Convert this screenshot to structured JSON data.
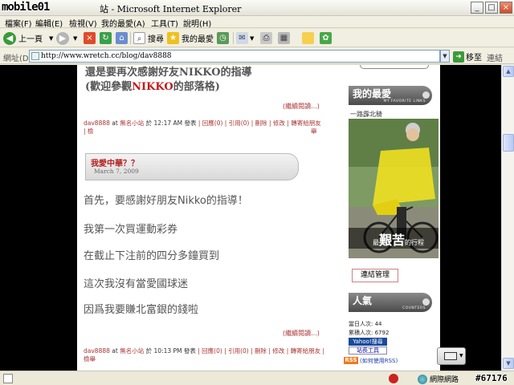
{
  "window": {
    "logo_text": "mobile01",
    "title_prefix": "站",
    "title": "Microsoft Internet Explorer",
    "minimize": "_",
    "maximize": "□",
    "close": "×"
  },
  "menu": [
    "檔案(F)",
    "編輯(E)",
    "檢視(V)",
    "我的最愛(A)",
    "工具(T)",
    "說明(H)"
  ],
  "toolbar": {
    "back_label": "上一頁",
    "search_label": "搜尋",
    "favorites_label": "我的最愛"
  },
  "address": {
    "label": "網址(D)",
    "url": "http://www.wretch.cc/blog/dav8888",
    "go_label": "移至",
    "links_label": "連結"
  },
  "banner": {
    "line1_text": "還是要再次感謝好友",
    "line1_name": "NIKKO",
    "line1_suffix": "的指導",
    "line2_prefix": "(歡迎參觀",
    "line2_name": "NIKKO",
    "line2_suffix": "的部落格)"
  },
  "posts": [
    {
      "more": "(繼續閱讀...)",
      "author": "dav8888",
      "at": "at",
      "site": "無名小站",
      "when": "於 12:17 AM 發表",
      "actions": "| 回應(0) | 引用(0) | 刪除 | 修改 | 轉寄給朋友 | 檢",
      "wrap": "舉"
    },
    {
      "title": "我愛中華？？",
      "date": "March 7, 2009",
      "lines": [
        "首先，要感謝好朋友Nikko的指導！",
        "我第一次買運動彩券",
        "在截止下注前的四分多鐘買到",
        "這次我沒有當愛國球迷",
        "因爲我要賺北富銀的錢啦"
      ],
      "more": "(繼續閱讀...)",
      "author": "dav8888",
      "at": "at",
      "site": "無名小站",
      "when": "於 10:13 PM 發表",
      "actions": "| 回應(0) | 引用(0) | 刪除 | 修改 | 轉寄給朋友 | 檢舉"
    }
  ],
  "sidebar": {
    "favorites_title": "我的最愛",
    "favorites_subtitle": "MY FAVORITE LINKS",
    "caption": "一路霹北騎",
    "photo_text_small": "最",
    "photo_text_big": "艱苦",
    "photo_text_after": "的行程",
    "links_button": "連結管理",
    "popularity_title": "人氣",
    "popularity_subtitle": "COUNTERS",
    "today_label": "當日人次: 44",
    "total_label": "累積人次: 6792",
    "yahoo_label": "Yahoo!搜尋",
    "tools_label": "站長工具",
    "rss_badge": "RSS",
    "rss_link": "(如何使用RSS)"
  },
  "statusbar": {
    "zone": "網際網路",
    "watermark": "#67176"
  }
}
